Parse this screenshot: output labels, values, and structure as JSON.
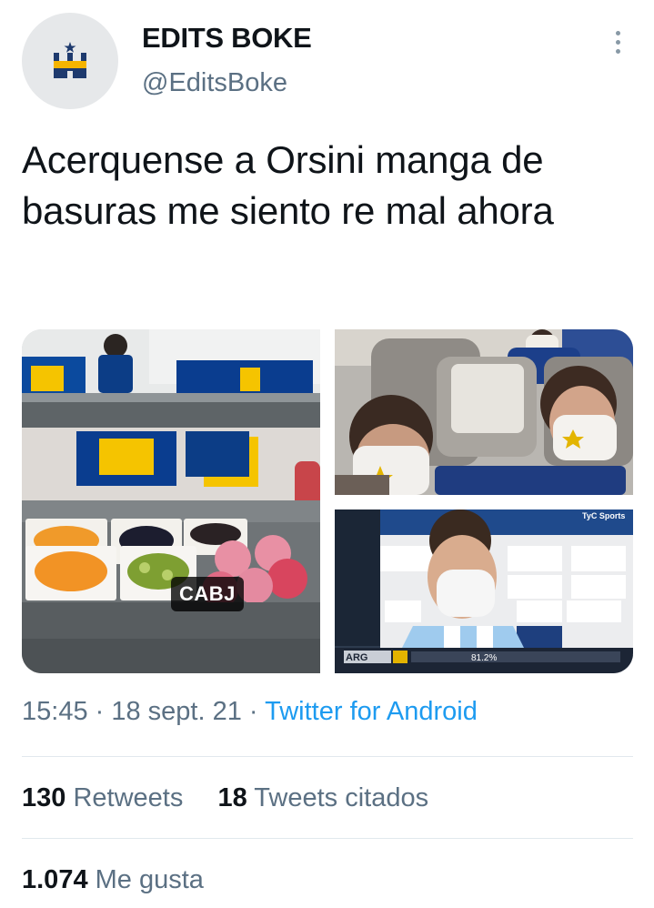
{
  "author": {
    "name": "EDITS BOKE",
    "handle": "@EditsBoke",
    "avatar_icon": "castle-icon"
  },
  "tweet": {
    "text": "Acerquense a Orsini manga de basuras me siento re mal ahora"
  },
  "media": {
    "photo1_tag": "CABJ",
    "photo3_broadcaster": "TyC Sports"
  },
  "meta": {
    "time": "15:45",
    "separator1": " · ",
    "date": "18 sept. 21",
    "separator2": " · ",
    "source": "Twitter for Android"
  },
  "stats": {
    "retweets_count": "130",
    "retweets_label": "Retweets",
    "quotes_count": "18",
    "quotes_label": "Tweets citados",
    "likes_count": "1.074",
    "likes_label": "Me gusta"
  },
  "colors": {
    "link": "#1d9bf0",
    "secondary_text": "#5b7083",
    "boca_blue": "#0a3d8f",
    "boca_yellow": "#f5c400"
  }
}
